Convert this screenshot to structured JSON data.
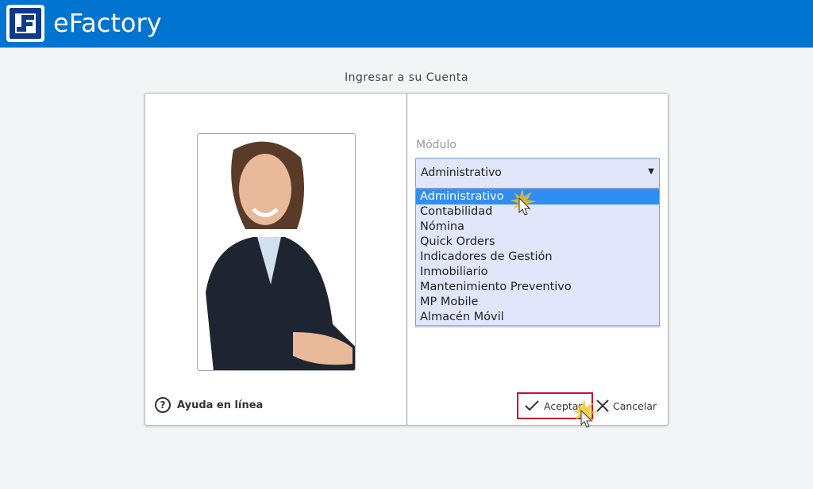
{
  "header": {
    "app_title": "eFactory"
  },
  "login": {
    "title": "Ingresar a su Cuenta",
    "help_label": "Ayuda en línea",
    "module_label": "Módulo",
    "selected_module": "Administrativo",
    "options": [
      "Administrativo",
      "Contabilidad",
      "Nómina",
      "Quick Orders",
      "Indicadores de Gestión",
      "Inmobiliario",
      "Mantenimiento Preventivo",
      "MP Mobile",
      "Almacén Móvil"
    ],
    "accept_label": "Aceptar",
    "cancel_label": "Cancelar"
  },
  "colors": {
    "header": "#0074d0",
    "highlight": "#2f8ef3",
    "accent_border": "#c8102e"
  }
}
